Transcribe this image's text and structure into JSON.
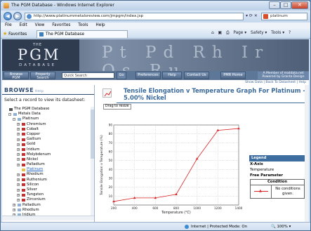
{
  "window": {
    "title": "The PGM Database - Windows Internet Explorer"
  },
  "address": {
    "url": "http://www.platinummetalsreview.com/jmpgm/index.jsp",
    "search": "platinum"
  },
  "menu": [
    "File",
    "Edit",
    "View",
    "Favorites",
    "Tools",
    "Help"
  ],
  "favbar": {
    "favorites": "Favorites",
    "tab": "The PGM Database",
    "tools": [
      "Page ▾",
      "Safety ▾",
      "Tools ▾"
    ]
  },
  "banner": {
    "the": "THE",
    "pgm": "PGM",
    "db": "DATABASE",
    "elements": "Pt Pd Rh Ir Os Ru"
  },
  "nav": {
    "browse": "Browse\nPGM",
    "property": "Property\nSearch",
    "quick": "Quick Search",
    "go": "Go",
    "prefs": "Preferences",
    "help": "Help",
    "contact": "Contact Us",
    "pmr": "PMR Home",
    "member": "A Member of matdata.net\nPowered by Granta Design"
  },
  "left": {
    "browse": "BROWSE",
    "help": "Help",
    "select": "Select a record to view its datasheet:",
    "tree": [
      {
        "label": "The PGM Database",
        "depth": 0,
        "icon": "db"
      },
      {
        "label": "Metals Data",
        "depth": 1,
        "icon": "fold",
        "exp": "−"
      },
      {
        "label": "Platinum",
        "depth": 2,
        "icon": "fold",
        "exp": "−"
      },
      {
        "label": "Chromium",
        "depth": 3,
        "icon": "red",
        "exp": "+"
      },
      {
        "label": "Cobalt",
        "depth": 3,
        "icon": "red",
        "exp": "+"
      },
      {
        "label": "Copper",
        "depth": 3,
        "icon": "red",
        "exp": "+"
      },
      {
        "label": "Gallium",
        "depth": 3,
        "icon": "red",
        "exp": "+"
      },
      {
        "label": "Gold",
        "depth": 3,
        "icon": "red",
        "exp": "+"
      },
      {
        "label": "Iridium",
        "depth": 3,
        "icon": "red",
        "exp": "+"
      },
      {
        "label": "Molybdenum",
        "depth": 3,
        "icon": "red",
        "exp": "+"
      },
      {
        "label": "Nickel",
        "depth": 3,
        "icon": "red",
        "exp": "+"
      },
      {
        "label": "Palladium",
        "depth": 3,
        "icon": "red",
        "exp": "+"
      },
      {
        "label": "Platinum",
        "depth": 3,
        "icon": "yel",
        "exp": "",
        "selected": true
      },
      {
        "label": "Rhodium",
        "depth": 3,
        "icon": "red",
        "exp": "+"
      },
      {
        "label": "Ruthenium",
        "depth": 3,
        "icon": "red",
        "exp": "+"
      },
      {
        "label": "Silicon",
        "depth": 3,
        "icon": "red",
        "exp": "+"
      },
      {
        "label": "Silver",
        "depth": 3,
        "icon": "red",
        "exp": "+"
      },
      {
        "label": "Tungsten",
        "depth": 3,
        "icon": "red",
        "exp": "+"
      },
      {
        "label": "Zirconium",
        "depth": 3,
        "icon": "red",
        "exp": "+"
      },
      {
        "label": "Palladium",
        "depth": 2,
        "icon": "fold",
        "exp": "+"
      },
      {
        "label": "Rhodium",
        "depth": 2,
        "icon": "fold",
        "exp": "+"
      },
      {
        "label": "Iridium",
        "depth": 2,
        "icon": "fold",
        "exp": "+"
      }
    ]
  },
  "right": {
    "links": "Show Data | Back To Datasheet | Help",
    "resize": "Drag to resize",
    "title": "Tensile Elongation v Temperature Graph For Platinum - 5.00% Nickel",
    "legend": {
      "header": "Legend",
      "xaxis_label": "X-Axis",
      "xaxis_value": "Temperature",
      "free_label": "Free Parameter",
      "condition_header": "Condition",
      "condition_text": "No conditions given."
    }
  },
  "chart_data": {
    "type": "line",
    "xlabel": "Temperature (°C)",
    "ylabel": "Tensile Elongation v Temperature (%)",
    "xlim": [
      200,
      1400
    ],
    "ylim": [
      0,
      90
    ],
    "xticks": [
      200,
      400,
      600,
      800,
      1000,
      1200,
      1400
    ],
    "yticks": [
      10,
      20,
      30,
      40,
      50,
      60,
      70,
      80,
      90
    ],
    "series": [
      {
        "x": [
          200,
          400,
          600,
          800,
          1000,
          1200,
          1400
        ],
        "y": [
          4,
          8,
          8,
          12,
          52,
          84,
          86
        ],
        "color": "#d92424"
      }
    ],
    "grid": true
  },
  "status": {
    "zone": "Internet | Protected Mode: On",
    "zoom": "100%"
  }
}
